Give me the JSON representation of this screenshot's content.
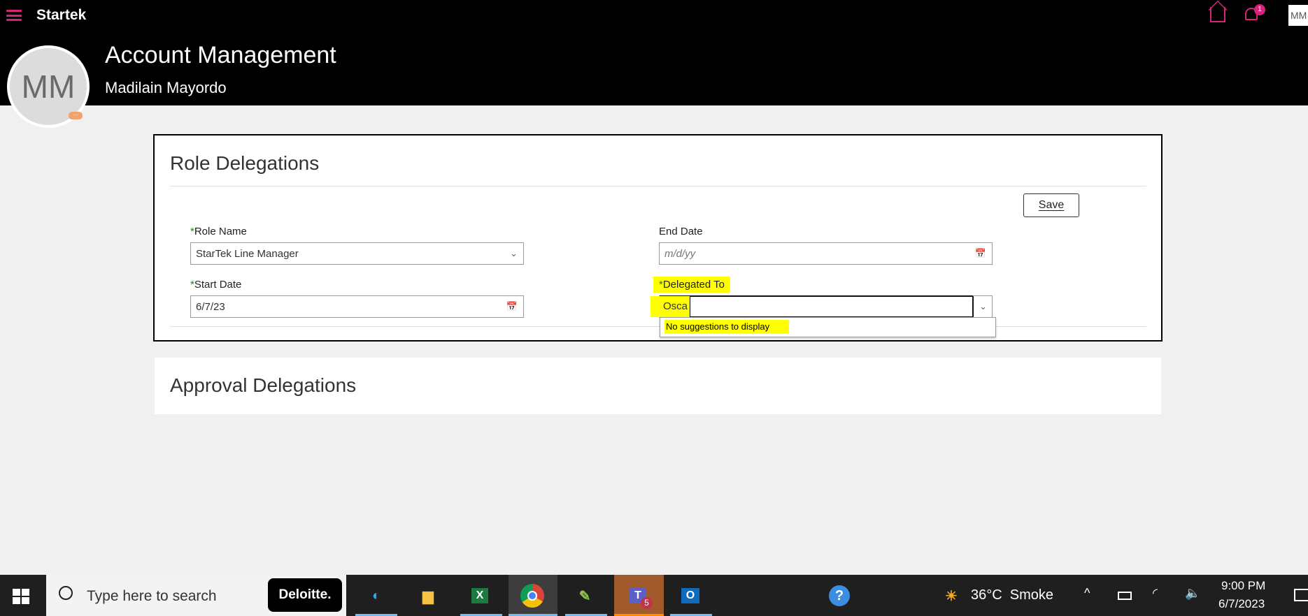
{
  "header": {
    "logo": "Startek",
    "title": "Account Management",
    "user_name": "Madilain Mayordo",
    "avatar_initials": "MM",
    "notification_count": "1",
    "top_avatar": "MM"
  },
  "role_delegations": {
    "title": "Role Delegations",
    "save_label": "Save",
    "role_name": {
      "label": "Role Name",
      "value": "StarTek Line Manager"
    },
    "end_date": {
      "label": "End Date",
      "placeholder": "m/d/yy"
    },
    "start_date": {
      "label": "Start Date",
      "value": "6/7/23"
    },
    "delegated_to": {
      "label": "Delegated To",
      "value": "Osca",
      "suggestion": "No suggestions to display"
    },
    "required_mark": "*"
  },
  "approval_delegations": {
    "title": "Approval Delegations"
  },
  "taskbar": {
    "search_placeholder": "Type here to search",
    "deloitte": "Deloitte.",
    "teams_badge": "5",
    "weather": "36°C  Smoke",
    "time": "9:00 PM",
    "date": "6/7/2023"
  },
  "colors": {
    "accent": "#d6237a",
    "highlight": "#ffff00"
  }
}
